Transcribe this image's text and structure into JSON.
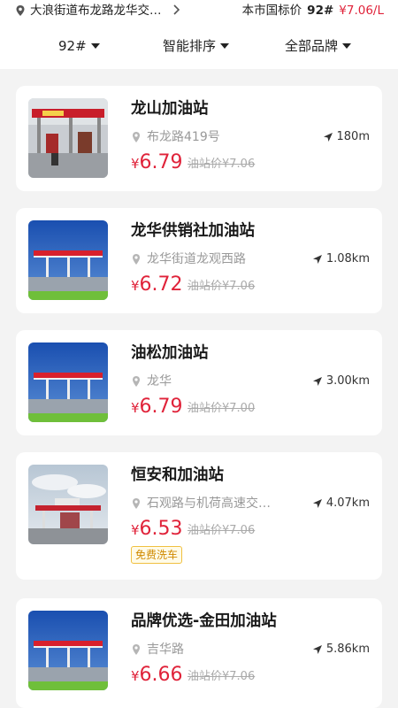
{
  "header": {
    "location": "大浪街道布龙路龙华交…",
    "city_price_label": "本市国标价",
    "city_price_grade": "92#",
    "city_price_value": "¥7.06/L"
  },
  "filters": {
    "fuel": "92#",
    "sort": "智能排序",
    "brand": "全部品牌"
  },
  "stations": [
    {
      "name": "龙山加油站",
      "address": "布龙路419号",
      "distance": "180m",
      "currency": "¥",
      "price": "6.79",
      "station_price": "油站价¥7.06",
      "tag": ""
    },
    {
      "name": "龙华供销社加油站",
      "address": "龙华街道龙观西路",
      "distance": "1.08km",
      "currency": "¥",
      "price": "6.72",
      "station_price": "油站价¥7.06",
      "tag": ""
    },
    {
      "name": "油松加油站",
      "address": "龙华",
      "distance": "3.00km",
      "currency": "¥",
      "price": "6.79",
      "station_price": "油站价¥7.00",
      "tag": ""
    },
    {
      "name": "恒安和加油站",
      "address": "石观路与机荷高速交…",
      "distance": "4.07km",
      "currency": "¥",
      "price": "6.53",
      "station_price": "油站价¥7.06",
      "tag": "免费洗车"
    },
    {
      "name": "品牌优选-金田加油站",
      "address": "吉华路",
      "distance": "5.86km",
      "currency": "¥",
      "price": "6.66",
      "station_price": "油站价¥7.06",
      "tag": ""
    }
  ],
  "icons": {
    "location_pin": "location-pin-icon",
    "chevron": "chevron-right-icon",
    "dropdown": "dropdown-triangle-icon",
    "distance": "navigation-arrow-icon"
  },
  "colors": {
    "accent_red": "#e0233a",
    "tag_yellow": "#d08a00",
    "muted": "#999999"
  }
}
